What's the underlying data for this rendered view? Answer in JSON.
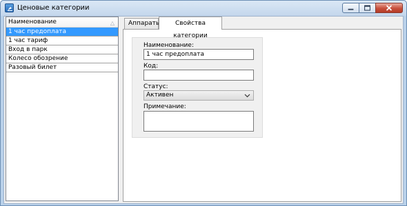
{
  "window": {
    "title": "Ценовые категории",
    "icon": "window-app-icon",
    "controls": [
      "minimize-icon",
      "maximize-icon",
      "close-icon"
    ]
  },
  "list": {
    "header": "Наименование",
    "sort_icon": "sort-ascending-icon",
    "items": [
      {
        "label": "1 час предоплата",
        "selected": true
      },
      {
        "label": "1 час тариф",
        "selected": false
      },
      {
        "label": "Вход в парк",
        "selected": false
      },
      {
        "label": "Колесо обозрение",
        "selected": false
      },
      {
        "label": "Разовый билет",
        "selected": false
      }
    ]
  },
  "tabs": [
    {
      "label": "Аппараты",
      "active": false
    },
    {
      "label": "Свойства категории",
      "active": true
    }
  ],
  "form": {
    "name_label": "Наименование:",
    "name_value": "1 час предоплата",
    "code_label": "Код:",
    "code_value": "",
    "status_label": "Статус:",
    "status_value": "Активен",
    "note_label": "Примечание:",
    "note_value": ""
  },
  "colors": {
    "selection": "#3399ff",
    "frame": "#b9d1ea",
    "close_button": "#c7503c"
  }
}
